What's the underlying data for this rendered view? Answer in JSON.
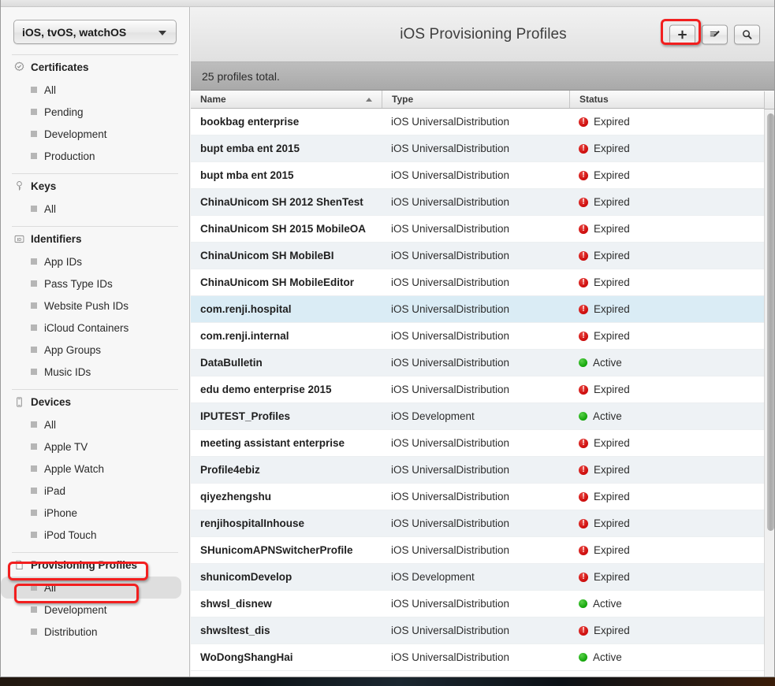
{
  "sidebar": {
    "platform_popup": {
      "value": "iOS, tvOS, watchOS",
      "arrow_icon": "chevron-down-icon"
    },
    "groups": [
      {
        "label": "Certificates",
        "icon": "certificate-seal-icon",
        "items": [
          {
            "label": "All"
          },
          {
            "label": "Pending"
          },
          {
            "label": "Development"
          },
          {
            "label": "Production"
          }
        ]
      },
      {
        "label": "Keys",
        "icon": "key-icon",
        "items": [
          {
            "label": "All"
          }
        ]
      },
      {
        "label": "Identifiers",
        "icon": "id-badge-icon",
        "items": [
          {
            "label": "App IDs"
          },
          {
            "label": "Pass Type IDs"
          },
          {
            "label": "Website Push IDs"
          },
          {
            "label": "iCloud Containers"
          },
          {
            "label": "App Groups"
          },
          {
            "label": "Music IDs"
          }
        ]
      },
      {
        "label": "Devices",
        "icon": "device-phone-icon",
        "items": [
          {
            "label": "All"
          },
          {
            "label": "Apple TV"
          },
          {
            "label": "Apple Watch"
          },
          {
            "label": "iPad"
          },
          {
            "label": "iPhone"
          },
          {
            "label": "iPod Touch"
          }
        ]
      },
      {
        "label": "Provisioning Profiles",
        "icon": "document-icon",
        "items": [
          {
            "label": "All"
          },
          {
            "label": "Development"
          },
          {
            "label": "Distribution"
          }
        ]
      }
    ]
  },
  "main": {
    "title": "iOS Provisioning Profiles",
    "toolbar": [
      {
        "name": "add-profile-button",
        "icon": "plus-icon"
      },
      {
        "name": "edit-profile-button",
        "icon": "edit-pencil-icon"
      },
      {
        "name": "search-button",
        "icon": "search-magnifier-icon"
      }
    ],
    "count_text": "25 profiles total.",
    "columns": [
      {
        "label": "Name",
        "sorted": "ascending"
      },
      {
        "label": "Type"
      },
      {
        "label": "Status"
      }
    ],
    "rows": [
      {
        "name": "bookbag enterprise",
        "type": "iOS UniversalDistribution",
        "status": "Expired"
      },
      {
        "name": "bupt emba ent 2015",
        "type": "iOS UniversalDistribution",
        "status": "Expired"
      },
      {
        "name": "bupt mba ent 2015",
        "type": "iOS UniversalDistribution",
        "status": "Expired"
      },
      {
        "name": "ChinaUnicom SH 2012 ShenTest",
        "type": "iOS UniversalDistribution",
        "status": "Expired"
      },
      {
        "name": "ChinaUnicom SH 2015 MobileOA",
        "type": "iOS UniversalDistribution",
        "status": "Expired"
      },
      {
        "name": "ChinaUnicom SH MobileBI",
        "type": "iOS UniversalDistribution",
        "status": "Expired"
      },
      {
        "name": "ChinaUnicom SH MobileEditor",
        "type": "iOS UniversalDistribution",
        "status": "Expired"
      },
      {
        "name": "com.renji.hospital",
        "type": "iOS UniversalDistribution",
        "status": "Expired",
        "selected": true
      },
      {
        "name": "com.renji.internal",
        "type": "iOS UniversalDistribution",
        "status": "Expired"
      },
      {
        "name": "DataBulletin",
        "type": "iOS UniversalDistribution",
        "status": "Active"
      },
      {
        "name": "edu demo enterprise 2015",
        "type": "iOS UniversalDistribution",
        "status": "Expired"
      },
      {
        "name": "IPUTEST_Profiles",
        "type": "iOS Development",
        "status": "Active"
      },
      {
        "name": "meeting assistant enterprise",
        "type": "iOS UniversalDistribution",
        "status": "Expired"
      },
      {
        "name": "Profile4ebiz",
        "type": "iOS UniversalDistribution",
        "status": "Expired"
      },
      {
        "name": "qiyezhengshu",
        "type": "iOS UniversalDistribution",
        "status": "Expired"
      },
      {
        "name": "renjihospitalInhouse",
        "type": "iOS UniversalDistribution",
        "status": "Expired"
      },
      {
        "name": "SHunicomAPNSwitcherProfile",
        "type": "iOS UniversalDistribution",
        "status": "Expired"
      },
      {
        "name": "shunicomDevelop",
        "type": "iOS Development",
        "status": "Expired"
      },
      {
        "name": "shwsl_disnew",
        "type": "iOS UniversalDistribution",
        "status": "Active"
      },
      {
        "name": "shwsltest_dis",
        "type": "iOS UniversalDistribution",
        "status": "Expired"
      },
      {
        "name": "WoDongShangHai",
        "type": "iOS UniversalDistribution",
        "status": "Active"
      }
    ]
  },
  "annotations": {
    "color": "#f21f1f",
    "targets": [
      "Provisioning Profiles",
      "All",
      "add-profile-button"
    ]
  },
  "selection": {
    "sidebar_selected_item": "All"
  }
}
